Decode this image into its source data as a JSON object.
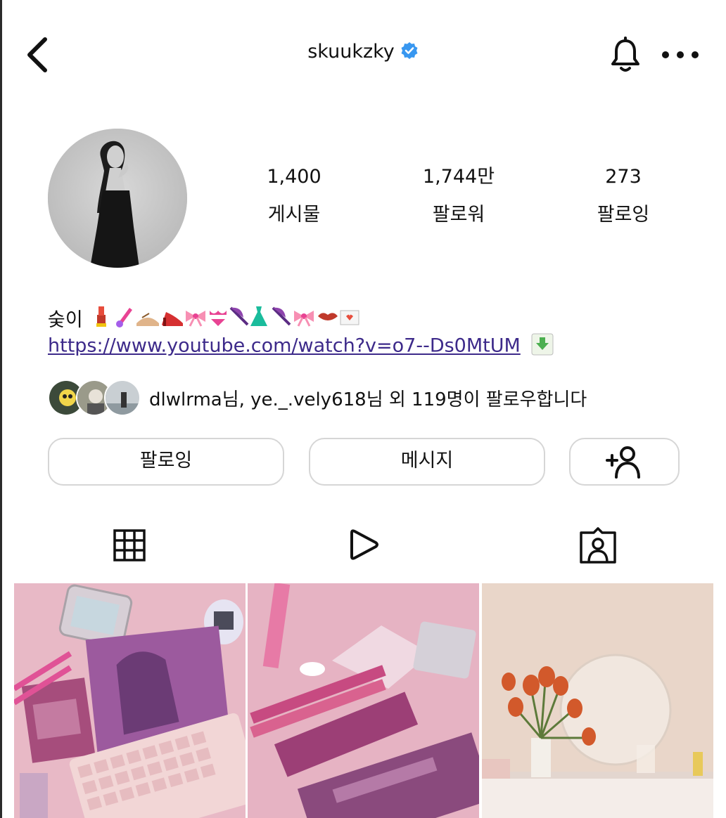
{
  "header": {
    "username": "skuukzky",
    "verified": true
  },
  "stats": [
    {
      "value": "1,400",
      "label": "게시물"
    },
    {
      "value": "1,744만",
      "label": "팔로워"
    },
    {
      "value": "273",
      "label": "팔로잉"
    }
  ],
  "bio": {
    "name": "숮이",
    "emojis": [
      "lipstick-icon",
      "nail-polish-icon",
      "sandal-icon",
      "high-heel-icon",
      "ribbon-icon",
      "bikini-icon",
      "umbrella-icon",
      "dress-icon",
      "umbrella-icon",
      "ribbon-icon",
      "lips-icon",
      "love-letter-icon"
    ],
    "link": "https://www.youtube.com/watch?v=o7--Ds0MtUM"
  },
  "followed_by": {
    "text": "dlwlrma님, ye._.vely618님 외 119명이 팔로우합니다"
  },
  "actions": {
    "follow_label": "팔로잉",
    "message_label": "메시지"
  },
  "tabs": [
    "grid-icon",
    "reels-icon",
    "tagged-icon"
  ],
  "colors": {
    "verified": "#3897f0",
    "link": "#3d2a8a",
    "button_border": "#d6d6d6"
  }
}
